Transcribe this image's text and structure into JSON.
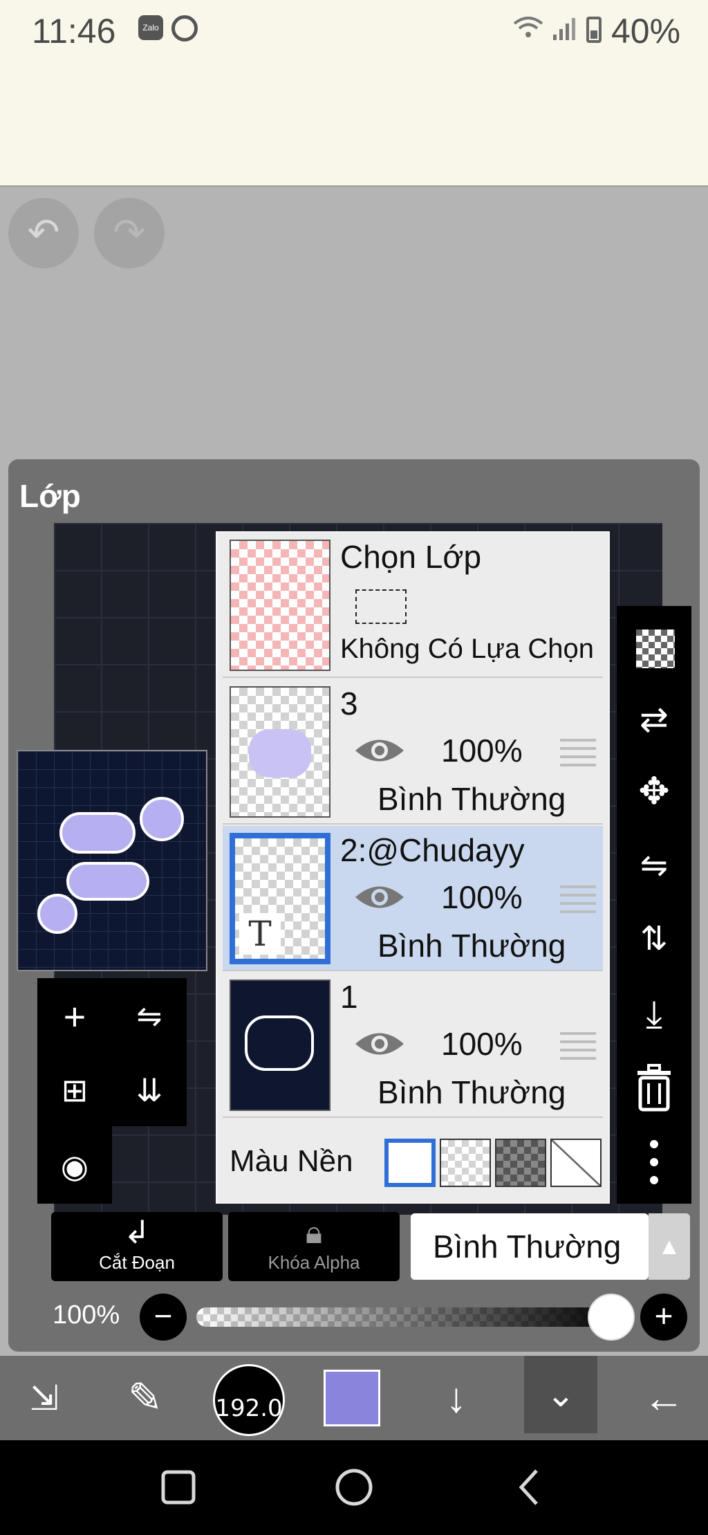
{
  "status_bar": {
    "time": "11:46",
    "notification_icons": [
      "zalo-icon",
      "chrome-icon"
    ],
    "system_icons": [
      "wifi-icon",
      "signal-icon",
      "battery-icon"
    ],
    "battery": "40%"
  },
  "history": {
    "undo_icon": "undo-icon",
    "redo_icon": "redo-icon"
  },
  "panel": {
    "title": "Lớp",
    "selection_layer": {
      "name": "Chọn Lớp",
      "status": "Không Có Lựa Chọn"
    },
    "layers": [
      {
        "name": "3",
        "opacity": "100%",
        "blend": "Bình Thường",
        "selected": false,
        "visible": true
      },
      {
        "name": "2:@Chudayy",
        "opacity": "100%",
        "blend": "Bình Thường",
        "selected": true,
        "visible": true
      },
      {
        "name": "1",
        "opacity": "100%",
        "blend": "Bình Thường",
        "selected": false,
        "visible": true
      }
    ],
    "text_layer_glyph": "T",
    "background": {
      "label": "Màu Nền",
      "options": [
        "white",
        "transparent",
        "dark-checker",
        "none"
      ],
      "selected": "white"
    },
    "left_tools": [
      "add-layer-icon",
      "flip-horizontal-icon",
      "add-copy-icon",
      "merge-down-icon",
      "camera-icon"
    ],
    "right_tools": [
      "checker-icon",
      "transform-icon",
      "move-icon",
      "flip-icon",
      "flip-vertical-icon",
      "download-icon",
      "trash-icon",
      "more-icon"
    ]
  },
  "actions": {
    "clipping": {
      "label": "Cắt Đoạn",
      "icon": "clip-arrow-icon"
    },
    "alpha_lock": {
      "label": "Khóa Alpha",
      "icon": "lock-alpha-icon"
    },
    "blend_mode": "Bình Thường",
    "blend_arrow": "▲"
  },
  "opacity_slider": {
    "label": "100%",
    "value": 1.0,
    "minus": "−",
    "plus": "+"
  },
  "toolbar": {
    "brush_size": "192.0",
    "current_color": "#8a85dc",
    "icons": [
      "swap-tools-icon",
      "brush-icon",
      "down-arrow-icon",
      "collapse-icon",
      "back-arrow-icon"
    ]
  },
  "navigation": {
    "icons": [
      "recent-apps-icon",
      "home-icon",
      "back-icon"
    ]
  },
  "colors": {
    "accent": "#2f6fd6",
    "selected_row": "#c9d8ee",
    "panel": "#707070"
  }
}
